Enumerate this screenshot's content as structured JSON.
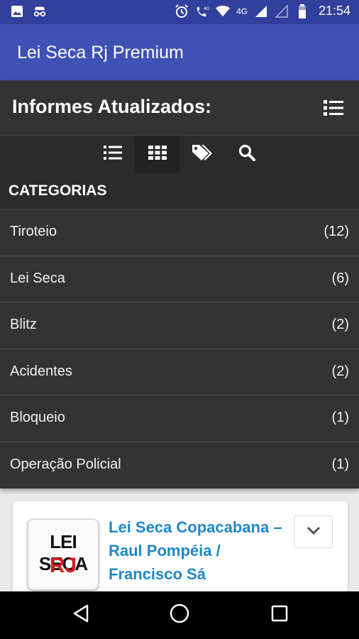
{
  "status_bar": {
    "time": "21:54",
    "network_label": "4G",
    "icons": [
      "image-icon",
      "incognito-icon",
      "alarm-icon",
      "wifi-call-icon",
      "wifi-icon",
      "signal-icon",
      "signal-empty-icon",
      "battery-icon"
    ]
  },
  "app_bar": {
    "title": "Lei Seca Rj Premium"
  },
  "panel": {
    "heading": "Informes Atualizados:",
    "menu_icon": "list-icon",
    "toolbar_icons": [
      "list-icon",
      "grid-icon",
      "tags-icon",
      "search-icon"
    ],
    "active_tool": "grid-icon"
  },
  "categories": {
    "title": "CATEGORIAS",
    "items": [
      {
        "name": "Tiroteio",
        "count": "(12)"
      },
      {
        "name": "Lei Seca",
        "count": "(6)"
      },
      {
        "name": "Blitz",
        "count": "(2)"
      },
      {
        "name": "Acidentes",
        "count": "(2)"
      },
      {
        "name": "Bloqueio",
        "count": "(1)"
      },
      {
        "name": "Operação Policial",
        "count": "(1)"
      }
    ]
  },
  "post": {
    "logo_line1": "LEI SECA",
    "logo_line2": "RJ",
    "title": "Lei Seca Copacabana – Raul Pompéia / Francisco Sá"
  },
  "nav_bar": {
    "icons": [
      "back-icon",
      "home-icon",
      "recents-icon"
    ]
  },
  "colors": {
    "status_bar": "#30409c",
    "app_bar": "#3f51b5",
    "panel": "#333333",
    "link": "#1e88c8"
  }
}
